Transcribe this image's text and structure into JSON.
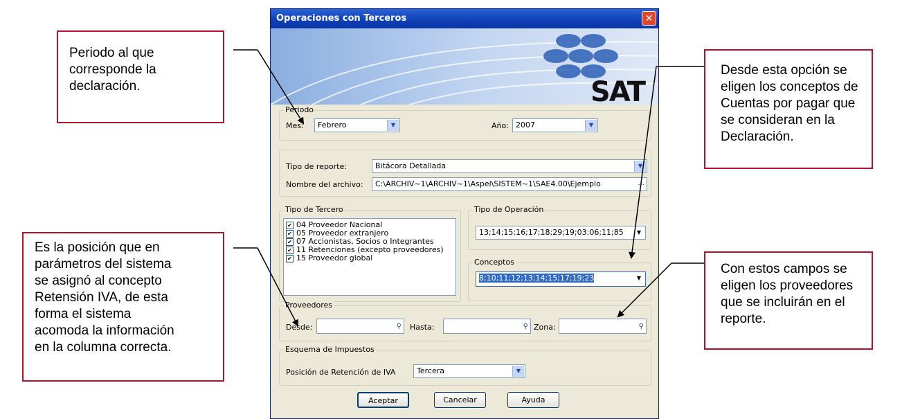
{
  "window": {
    "title": "Operaciones con Terceros",
    "close_symbol": "✕",
    "banner_logo": "SAT"
  },
  "periodo": {
    "legend": "Periodo",
    "mes_label": "Mes:",
    "mes_value": "Febrero",
    "anio_label": "Año:",
    "anio_value": "2007"
  },
  "reporte": {
    "tipo_label": "Tipo de reporte:",
    "tipo_value": "Bitácora Detallada",
    "archivo_label": "Nombre del archivo:",
    "archivo_value": "C:\\ARCHIV~1\\ARCHIV~1\\Aspel\\SISTEM~1\\SAE4.00\\Ejemplo",
    "browse_symbol": "···"
  },
  "tipo_tercero": {
    "legend": "Tipo de Tercero",
    "items": [
      {
        "label": "04 Proveedor Nacional",
        "checked": true
      },
      {
        "label": "05 Proveedor extranjero",
        "checked": true
      },
      {
        "label": "07 Accionistas, Socios o Integrantes",
        "checked": true
      },
      {
        "label": "11 Retenciones (excepto proveedores)",
        "checked": true
      },
      {
        "label": "15 Proveedor global",
        "checked": true
      }
    ]
  },
  "tipo_operacion": {
    "legend": "Tipo de Operación",
    "value": "13;14;15;16;17;18;29;19;03;06;11;85"
  },
  "conceptos": {
    "legend": "Conceptos",
    "value": "8;10;11;12;13;14;15;17;19;23"
  },
  "proveedores": {
    "legend": "Proveedores",
    "desde_label": "Desde:",
    "hasta_label": "Hasta:",
    "zona_label": "Zona:"
  },
  "impuestos": {
    "legend": "Esquema de Impuestos",
    "posicion_label": "Posición de Retención de IVA",
    "posicion_value": "Tercera"
  },
  "buttons": {
    "aceptar": "Aceptar",
    "cancelar": "Cancelar",
    "ayuda": "Ayuda"
  },
  "callouts": {
    "periodo": [
      "Periodo al que",
      "corresponde la",
      "declaración."
    ],
    "conceptos": [
      "Desde esta opción se",
      "eligen los conceptos de",
      "Cuentas por pagar que",
      "se consideran en la",
      "Declaración."
    ],
    "retencion": [
      "Es la posición que en",
      "parámetros del sistema",
      "se asignó al concepto",
      "Retensión IVA, de esta",
      "forma el sistema",
      "acomoda la información",
      "en la columna correcta."
    ],
    "proveedores": [
      "Con estos campos se",
      "eligen los proveedores",
      "que se incluirán en el",
      "reporte."
    ]
  },
  "colors": {
    "callout_border": "#b3122e",
    "title_bar": "#0f3fb4",
    "dialog_bg": "#ece9d8"
  }
}
